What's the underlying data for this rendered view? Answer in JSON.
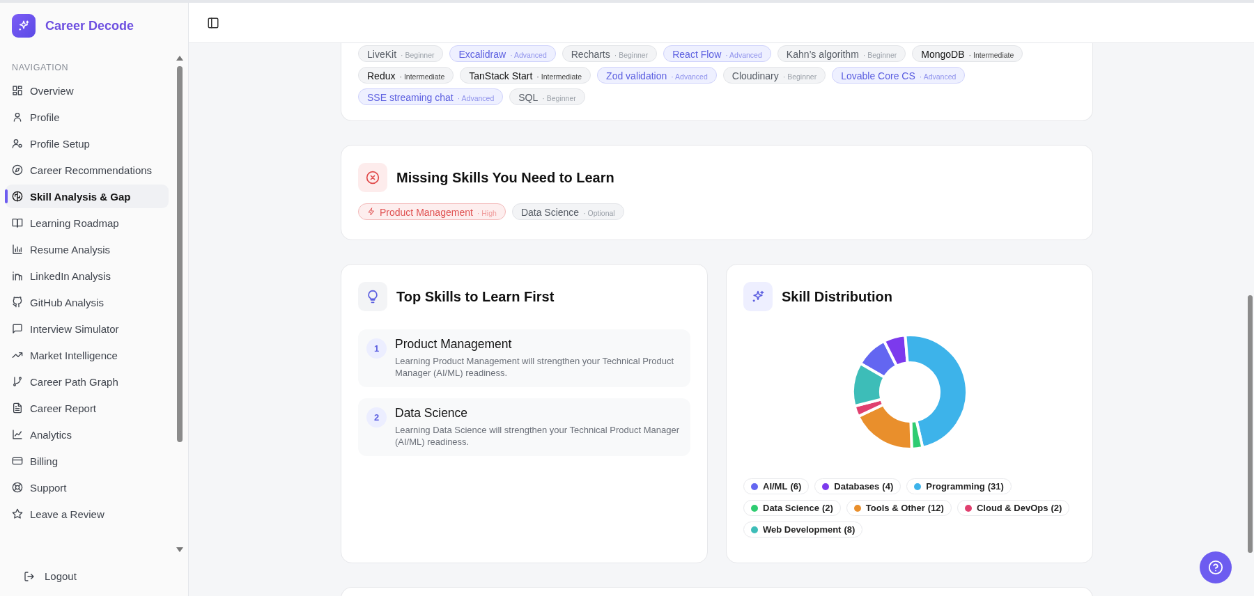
{
  "sidebar": {
    "brand": "Career Decode",
    "section_label": "NAVIGATION",
    "items": [
      {
        "label": "Overview",
        "selected": false
      },
      {
        "label": "Profile",
        "selected": false
      },
      {
        "label": "Profile Setup",
        "selected": false
      },
      {
        "label": "Career Recommendations",
        "selected": false
      },
      {
        "label": "Skill Analysis & Gap",
        "selected": true
      },
      {
        "label": "Learning Roadmap",
        "selected": false
      },
      {
        "label": "Resume Analysis",
        "selected": false
      },
      {
        "label": "LinkedIn Analysis",
        "selected": false
      },
      {
        "label": "GitHub Analysis",
        "selected": false
      },
      {
        "label": "Interview Simulator",
        "selected": false
      },
      {
        "label": "Market Intelligence",
        "selected": false
      },
      {
        "label": "Career Path Graph",
        "selected": false
      },
      {
        "label": "Career Report",
        "selected": false
      },
      {
        "label": "Analytics",
        "selected": false
      },
      {
        "label": "Billing",
        "selected": false
      },
      {
        "label": "Support",
        "selected": false
      },
      {
        "label": "Leave a Review",
        "selected": false
      }
    ],
    "logout": "Logout"
  },
  "current_skills": [
    {
      "name": "LiveKit",
      "tier": "· Beginner",
      "kind": "beginner"
    },
    {
      "name": "Excalidraw",
      "tier": "· Advanced",
      "kind": "advanced"
    },
    {
      "name": "Recharts",
      "tier": "· Beginner",
      "kind": "beginner"
    },
    {
      "name": "React Flow",
      "tier": "· Advanced",
      "kind": "advanced"
    },
    {
      "name": "Kahn’s algorithm",
      "tier": "· Beginner",
      "kind": "beginner"
    },
    {
      "name": "MongoDB",
      "tier": "· Intermediate",
      "kind": "intermediate"
    },
    {
      "name": "Redux",
      "tier": "· Intermediate",
      "kind": "intermediate"
    },
    {
      "name": "TanStack Start",
      "tier": "· Intermediate",
      "kind": "intermediate"
    },
    {
      "name": "Zod validation",
      "tier": "· Advanced",
      "kind": "advanced"
    },
    {
      "name": "Cloudinary",
      "tier": "· Beginner",
      "kind": "beginner"
    },
    {
      "name": "Lovable Core CS",
      "tier": "· Advanced",
      "kind": "advanced"
    },
    {
      "name": "SSE streaming chat",
      "tier": "· Advanced",
      "kind": "advanced"
    },
    {
      "name": "SQL",
      "tier": "· Beginner",
      "kind": "beginner"
    }
  ],
  "missing_skills": {
    "title": "Missing Skills You Need to Learn",
    "items": [
      {
        "name": "Product Management",
        "priority": "· High",
        "kind": "high"
      },
      {
        "name": "Data Science",
        "priority": "· Optional",
        "kind": "optional"
      }
    ]
  },
  "top_skills": {
    "title": "Top Skills to Learn First",
    "items": [
      {
        "number": "1",
        "name": "Product Management",
        "description": "Learning Product Management will strengthen your Technical Product Manager (AI/ML) readiness."
      },
      {
        "number": "2",
        "name": "Data Science",
        "description": "Learning Data Science will strengthen your Technical Product Manager (AI/ML) readiness."
      }
    ]
  },
  "skill_distribution": {
    "title": "Skill Distribution",
    "chart_data": {
      "type": "donut",
      "categories": [
        "AI/ML",
        "Databases",
        "Programming",
        "Data Science",
        "Tools & Other",
        "Cloud & DevOps",
        "Web Development"
      ],
      "series": [
        {
          "values": [
            9.23,
            6.15,
            47.69,
            3.08,
            18.46,
            3.08,
            12.31
          ]
        }
      ]
    },
    "legend": [
      {
        "count": "(6)",
        "color": "#6366f1"
      },
      {
        "count": "(4)",
        "color": "#7c3aed"
      },
      {
        "count": "(31)",
        "color": "#3db3ea"
      },
      {
        "count": "(2)",
        "color": "#2ecc71"
      },
      {
        "count": "(12)",
        "color": "#e98f2c"
      },
      {
        "count": "(2)",
        "color": "#e0406f"
      },
      {
        "count": "(8)",
        "color": "#3dbdb8"
      }
    ]
  }
}
